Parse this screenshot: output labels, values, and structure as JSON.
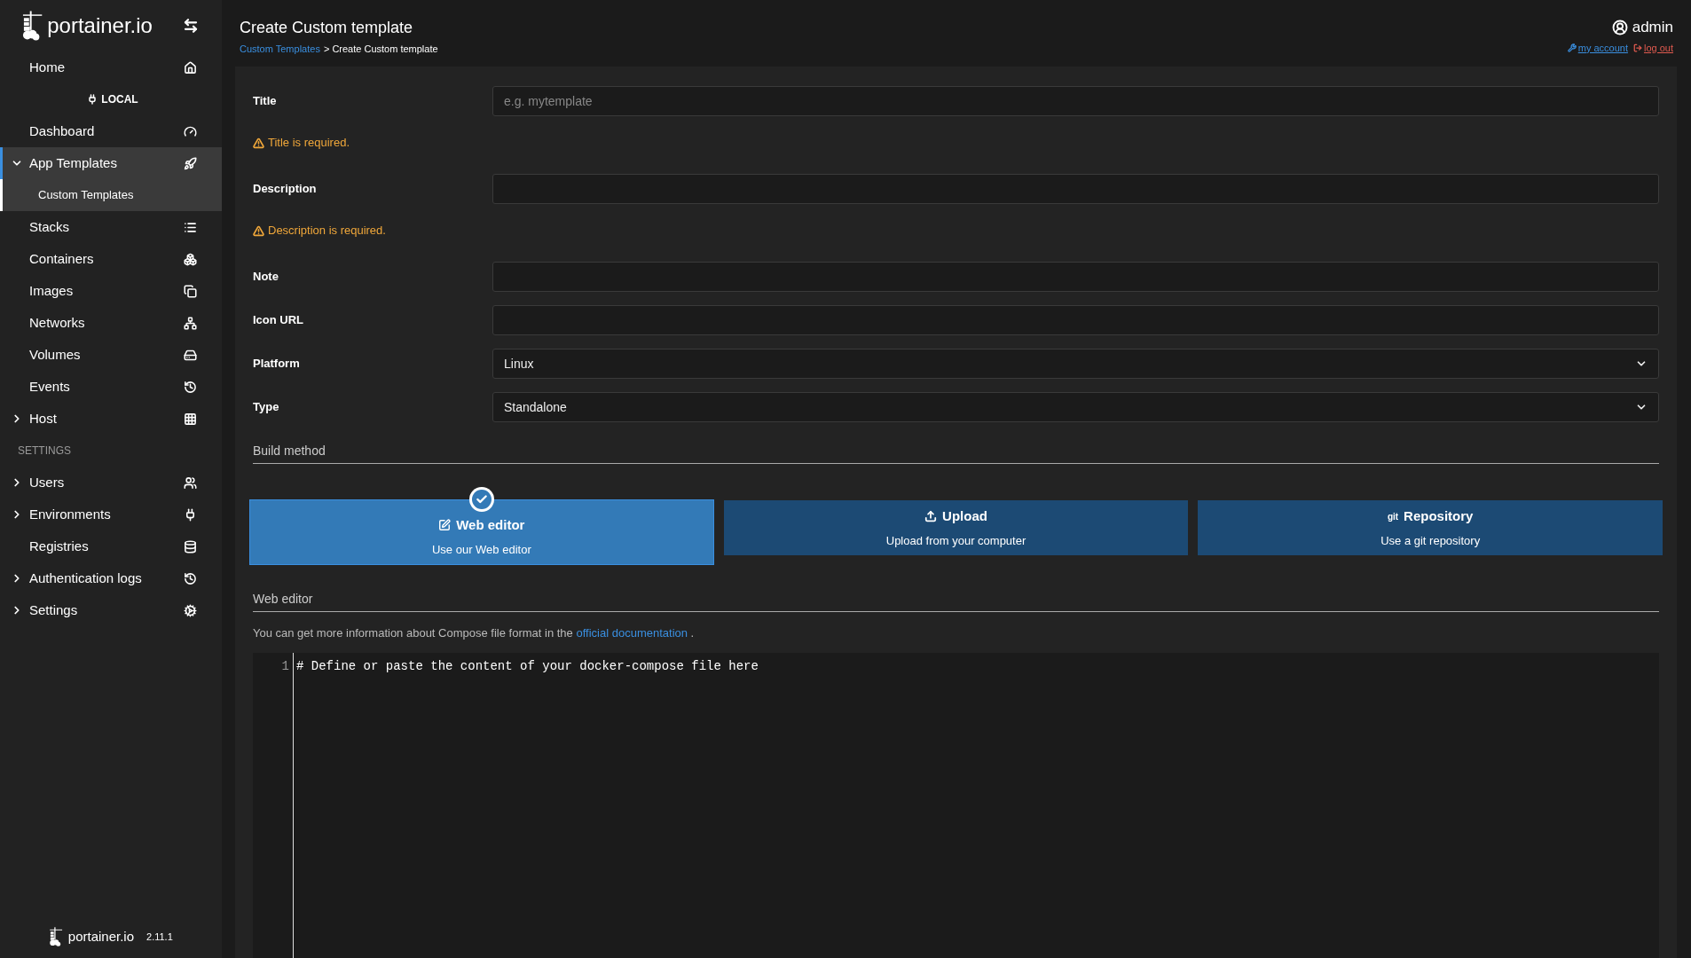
{
  "logo": {
    "text": "portainer.io"
  },
  "sidebar": {
    "items": [
      {
        "kind": "link",
        "label": "Home",
        "selected": false
      },
      {
        "kind": "endpoint",
        "label": "LOCAL"
      },
      {
        "kind": "link",
        "label": "Dashboard",
        "selected": false
      },
      {
        "kind": "group",
        "label": "App Templates",
        "selected": true,
        "expanded": true,
        "children": [
          {
            "label": "Custom Templates",
            "selected": true
          }
        ]
      },
      {
        "kind": "link",
        "label": "Stacks",
        "selected": false
      },
      {
        "kind": "link",
        "label": "Containers",
        "selected": false
      },
      {
        "kind": "link",
        "label": "Images",
        "selected": false
      },
      {
        "kind": "link",
        "label": "Networks",
        "selected": false
      },
      {
        "kind": "link",
        "label": "Volumes",
        "selected": false
      },
      {
        "kind": "link",
        "label": "Events",
        "selected": false
      },
      {
        "kind": "group",
        "label": "Host",
        "selected": false,
        "expanded": false
      },
      {
        "kind": "heading",
        "label": "SETTINGS"
      },
      {
        "kind": "group",
        "label": "Users",
        "selected": false,
        "expanded": false
      },
      {
        "kind": "group",
        "label": "Environments",
        "selected": false,
        "expanded": false
      },
      {
        "kind": "link",
        "label": "Registries",
        "selected": false
      },
      {
        "kind": "group",
        "label": "Authentication logs",
        "selected": false,
        "expanded": false
      },
      {
        "kind": "group",
        "label": "Settings",
        "selected": false,
        "expanded": false
      }
    ]
  },
  "footer": {
    "logo": "portainer.io",
    "version": "2.11.1"
  },
  "header": {
    "title": "Create Custom template",
    "breadcrumb": {
      "link": "Custom Templates",
      "separator": ">",
      "current": "Create Custom template"
    },
    "user": "admin",
    "account_link": "my account",
    "logout_link": "log out"
  },
  "form": {
    "fields": [
      {
        "kind": "text",
        "label": "Title",
        "placeholder": "e.g. mytemplate",
        "error": "Title is required."
      },
      {
        "kind": "text",
        "label": "Description",
        "error": "Description is required."
      },
      {
        "kind": "text",
        "label": "Note"
      },
      {
        "kind": "text",
        "label": "Icon URL"
      },
      {
        "kind": "select",
        "label": "Platform",
        "value": "Linux"
      },
      {
        "kind": "select",
        "label": "Type",
        "value": "Standalone"
      }
    ]
  },
  "build_method": {
    "title": "Build method",
    "options": [
      {
        "title": "Web editor",
        "subtitle": "Use our Web editor",
        "selected": true
      },
      {
        "title": "Upload",
        "subtitle": "Upload from your computer",
        "selected": false
      },
      {
        "title": "Repository",
        "subtitle": "Use a git repository",
        "selected": false,
        "icon_text": "git"
      }
    ]
  },
  "web_editor": {
    "title": "Web editor",
    "help": {
      "before": "You can get more information about Compose file format in the",
      "link": "official documentation",
      "after": "."
    },
    "lines": [
      {
        "number": "1",
        "text": "# Define or paste the content of your docker-compose file here"
      }
    ]
  }
}
